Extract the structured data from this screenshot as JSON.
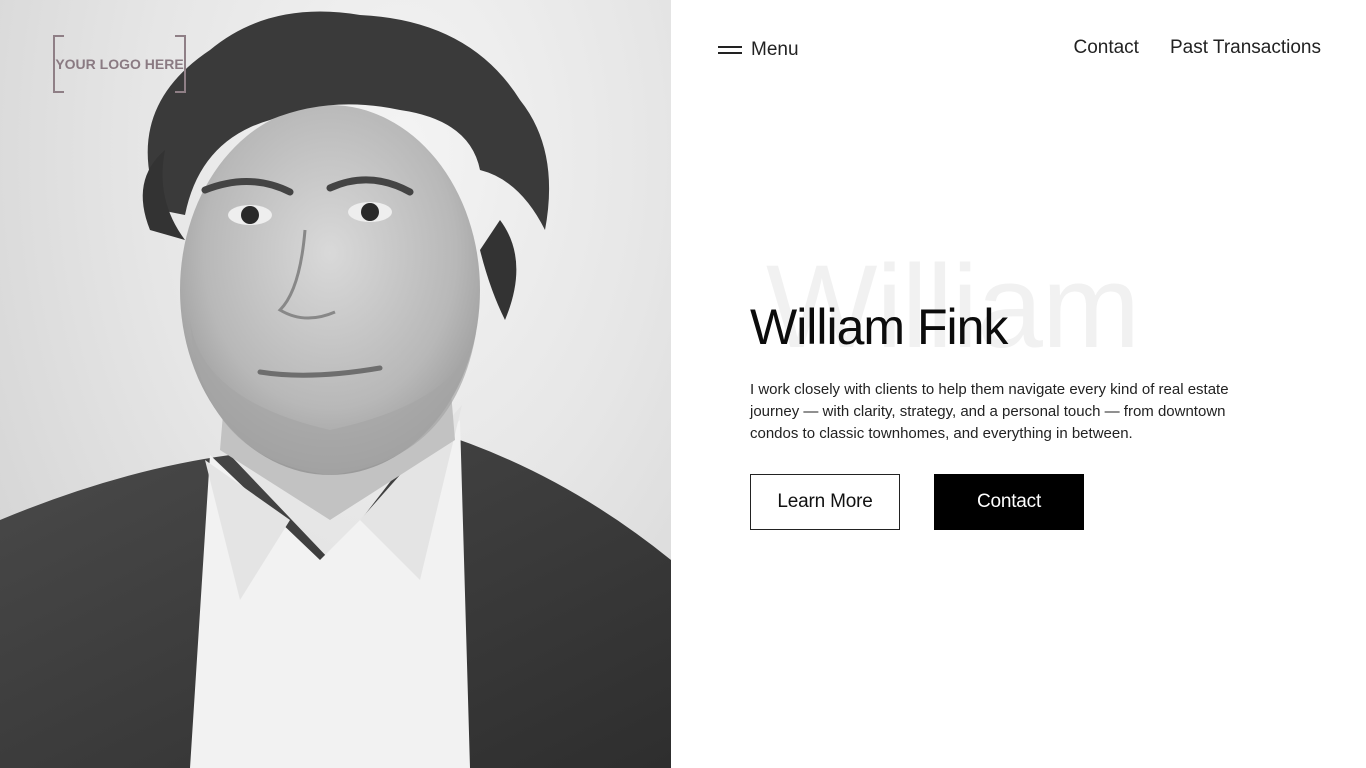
{
  "logo": {
    "text": "YOUR LOGO HERE"
  },
  "nav": {
    "menu_label": "Menu",
    "links": [
      "Contact",
      "Past Transactions"
    ]
  },
  "hero": {
    "watermark": "William",
    "name": "William Fink",
    "description": "I work closely with clients to help them navigate every kind of real estate journey — with clarity, strategy, and a personal touch — from downtown condos to classic townhomes, and everything in between.",
    "primary_button": "Learn More",
    "secondary_button": "Contact"
  },
  "colors": {
    "background": "#ffffff",
    "text": "#111111",
    "button_solid": "#000000",
    "logo": "#8a7a82",
    "watermark": "#f1f1f1"
  }
}
